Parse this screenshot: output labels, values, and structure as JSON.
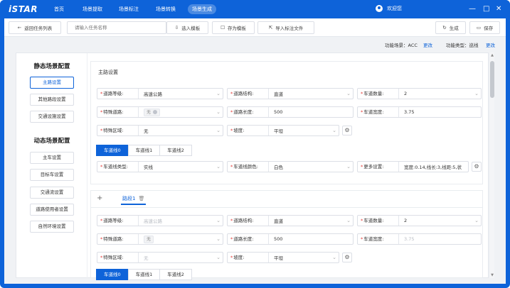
{
  "app": {
    "logo": "iSTAR"
  },
  "nav": [
    {
      "label": "首页"
    },
    {
      "label": "场景提取"
    },
    {
      "label": "场景标注"
    },
    {
      "label": "场景转换"
    },
    {
      "label": "场景生成"
    }
  ],
  "user": {
    "greeting": "欢迎您"
  },
  "window": {
    "minimize": "—",
    "maximize": "□",
    "close": "✕"
  },
  "toolbar": {
    "back_label": "返回任务列表",
    "search_placeholder": "请输入任务名称",
    "select_template": "选入模板",
    "save_template": "存为模板",
    "import_label_file": "导入标注文件",
    "generate": "生成",
    "save": "保存"
  },
  "funcbar": {
    "scene_label": "功能场景：ACC",
    "scene_change": "更改",
    "type_label": "功能类型：巡线",
    "type_change": "更改"
  },
  "sidebar": {
    "static_title": "静态场景配置",
    "static_items": [
      "主路设置",
      "其他路段设置",
      "交通设施设置"
    ],
    "dynamic_title": "动态场景配置",
    "dynamic_items": [
      "主车设置",
      "目标车设置",
      "交通流设置",
      "道路使用者设置",
      "自然环境设置"
    ]
  },
  "main_road": {
    "title": "主路设置",
    "road_level": {
      "label": "道路等级:",
      "value": "高速公路"
    },
    "road_structure": {
      "label": "道路结构:",
      "value": "直道"
    },
    "lane_count": {
      "label": "车道数量:",
      "value": "2"
    },
    "special_road": {
      "label": "特殊道路:",
      "value": "无"
    },
    "road_length": {
      "label": "道路长度:",
      "value": "500"
    },
    "lane_width": {
      "label": "车道宽度:",
      "value": "3.75"
    },
    "special_area": {
      "label": "特殊区域:",
      "value": "无"
    },
    "slope": {
      "label": "坡度:",
      "value": "平坦"
    },
    "lane_tabs": [
      "车道线0",
      "车道线1",
      "车道线2"
    ],
    "line_type": {
      "label": "车道线类型:",
      "value": "实线"
    },
    "line_color": {
      "label": "车道线颜色:",
      "value": "白色"
    },
    "more_settings": {
      "label": "更多设置:",
      "value": "宽度:0.14,线长:3,线距:5,状"
    }
  },
  "road_section": {
    "add_icon": "+",
    "tab_label": "路段1",
    "road_level": {
      "label": "道路等级:",
      "value": "高速公路"
    },
    "road_structure": {
      "label": "道路结构:",
      "value": "直道"
    },
    "lane_count": {
      "label": "车道数量:",
      "value": "2"
    },
    "special_road": {
      "label": "特殊道路:",
      "value": "无"
    },
    "road_length": {
      "label": "道路长度:",
      "value": "500"
    },
    "lane_width": {
      "label": "车道宽度:",
      "value": "3.75"
    },
    "special_area": {
      "label": "特殊区域:",
      "value": "无"
    },
    "slope": {
      "label": "坡度:",
      "value": "平坦"
    },
    "lane_tabs": [
      "车道线0",
      "车道线1",
      "车道线2"
    ]
  },
  "colors": {
    "primary": "#0e63d9",
    "required": "#e53935"
  }
}
